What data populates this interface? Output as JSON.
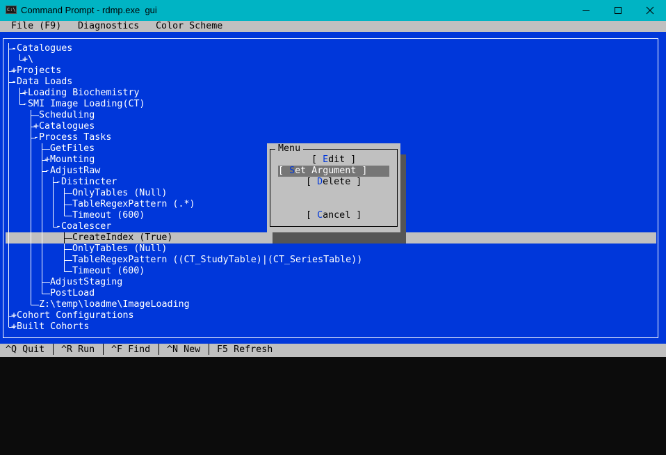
{
  "window": {
    "title": "Command Prompt - rdmp.exe  gui",
    "icon": "console-icon",
    "controls": [
      "minimize-icon",
      "maximize-icon",
      "close-icon"
    ]
  },
  "menubar": {
    "items": [
      "File (F9)",
      "Diagnostics",
      "Color Scheme"
    ]
  },
  "tree": {
    "nodes": [
      {
        "prefix": "-",
        "label": "Catalogues"
      },
      {
        "prefix": "+",
        "label": "\\"
      },
      {
        "prefix": "+",
        "label": "Projects"
      },
      {
        "prefix": "-",
        "label": "Data Loads"
      },
      {
        "prefix": "+",
        "label": "Loading Biochemistry"
      },
      {
        "prefix": "-",
        "label": "SMI Image Loading(CT)"
      },
      {
        "prefix": "",
        "label": "Scheduling"
      },
      {
        "prefix": "+",
        "label": "Catalogues"
      },
      {
        "prefix": "-",
        "label": "Process Tasks"
      },
      {
        "prefix": "",
        "label": "GetFiles"
      },
      {
        "prefix": "+",
        "label": "Mounting"
      },
      {
        "prefix": "-",
        "label": "AdjustRaw"
      },
      {
        "prefix": "-",
        "label": "Distincter"
      },
      {
        "prefix": "",
        "label": "OnlyTables (Null)"
      },
      {
        "prefix": "",
        "label": "TableRegexPattern (.*)"
      },
      {
        "prefix": "",
        "label": "Timeout (600)"
      },
      {
        "prefix": "-",
        "label": "Coalescer"
      },
      {
        "prefix": "",
        "label": "CreateIndex (True)"
      },
      {
        "prefix": "",
        "label": "OnlyTables (Null)"
      },
      {
        "prefix": "",
        "label": "TableRegexPattern ((CT_StudyTable)|(CT_SeriesTable))"
      },
      {
        "prefix": "",
        "label": "Timeout (600)"
      },
      {
        "prefix": "",
        "label": "AdjustStaging"
      },
      {
        "prefix": "",
        "label": "PostLoad"
      },
      {
        "prefix": "",
        "label": "Z:\\temp\\loadme\\ImageLoading"
      },
      {
        "prefix": "+",
        "label": "Cohort Configurations"
      },
      {
        "prefix": "+",
        "label": "Built Cohorts"
      }
    ],
    "selected_label": "CreateIndex (True)"
  },
  "dialog": {
    "title": "Menu",
    "buttons": [
      {
        "open": "[ ",
        "hotkey": "E",
        "rest": "dit",
        "close": " ]"
      },
      {
        "open": "[ ",
        "hotkey": "S",
        "rest": "et Argument",
        "close": " ]"
      },
      {
        "open": "[ ",
        "hotkey": "D",
        "rest": "elete",
        "close": " ]"
      },
      {
        "open": "[ ",
        "hotkey": "C",
        "rest": "ancel",
        "close": " ]"
      }
    ],
    "focused_button": "Set Argument"
  },
  "statusbar": {
    "items": [
      "^Q Quit",
      "^R Run",
      "^F Find",
      "^N New",
      "F5 Refresh"
    ]
  },
  "colors": {
    "titlebar": "#00b4c4",
    "panel": "#0037da",
    "menubar": "#c0c0c0",
    "selection": "#c0c0c0",
    "focused_button": "#767676",
    "hotkey": "#0037da"
  }
}
